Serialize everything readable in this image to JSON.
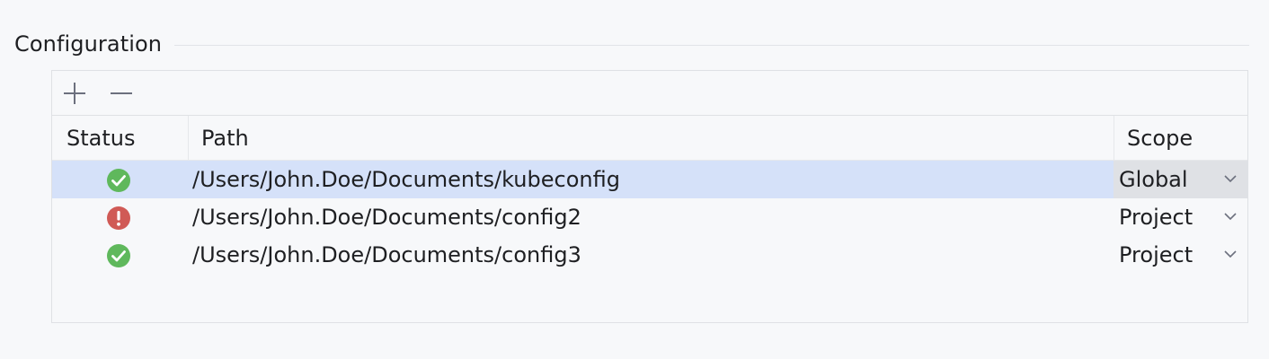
{
  "section": {
    "title": "Configuration"
  },
  "toolbar": {
    "add_icon": "plus-icon",
    "remove_icon": "minus-icon"
  },
  "table": {
    "columns": [
      "Status",
      "Path",
      "Scope"
    ],
    "rows": [
      {
        "status": "ok",
        "path": "/Users/John.Doe/Documents/kubeconfig",
        "scope": "Global",
        "selected": true
      },
      {
        "status": "error",
        "path": "/Users/John.Doe/Documents/config2",
        "scope": "Project",
        "selected": false
      },
      {
        "status": "ok",
        "path": "/Users/John.Doe/Documents/config3",
        "scope": "Project",
        "selected": false
      }
    ]
  },
  "colors": {
    "ok": "#5fb85c",
    "error": "#d05a56",
    "selection": "#d5e1f9"
  }
}
